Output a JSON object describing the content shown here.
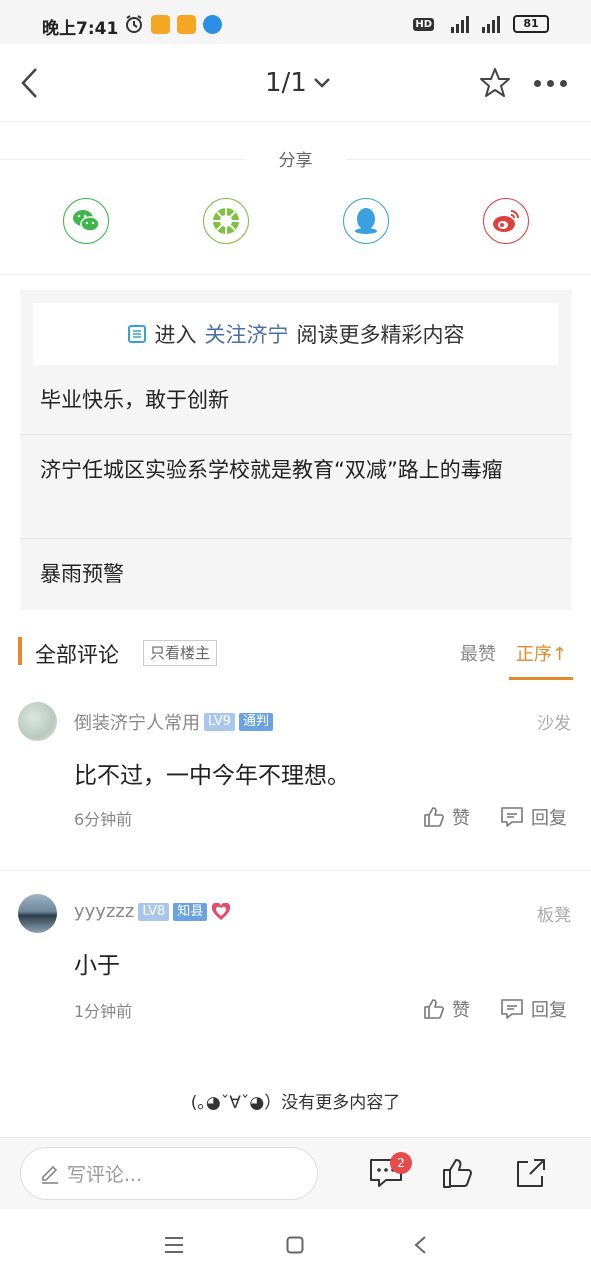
{
  "status_bar": {
    "time": "晚上7:41",
    "signal_label": "4G",
    "hd_label": "HD",
    "battery": "81"
  },
  "nav": {
    "page_indicator": "1/1",
    "back_icon": "back-arrow-icon",
    "star_icon": "star-icon",
    "more_icon": "more-dots-icon"
  },
  "share": {
    "title": "分享",
    "items": [
      {
        "name": "wechat",
        "color": "#3fb64b"
      },
      {
        "name": "moments",
        "color": "#7cc13f"
      },
      {
        "name": "qq",
        "color": "#3aa0e0"
      },
      {
        "name": "weibo",
        "color": "#e0403c"
      }
    ]
  },
  "related": {
    "enter_prefix": "进入",
    "enter_link": "关注济宁",
    "enter_suffix": "阅读更多精彩内容",
    "items": [
      "毕业快乐，敢于创新",
      "济宁任城区实验系学校就是教育“双减”路上的毒瘤",
      "暴雨预警"
    ]
  },
  "comments_header": {
    "title": "全部评论",
    "only_author": "只看楼主",
    "sort_hot": "最赞",
    "sort_order": "正序↑"
  },
  "comments": [
    {
      "user": "倒装济宁人常用",
      "level": "LV9",
      "rank": "通判",
      "floor": "沙发",
      "text": "比不过，一中今年不理想。",
      "time": "6分钟前",
      "like": "赞",
      "reply": "回复"
    },
    {
      "user": "yyyzzz",
      "level": "LV8",
      "rank": "知县",
      "floor": "板凳",
      "text": "小于",
      "time": "1分钟前",
      "like": "赞",
      "reply": "回复"
    }
  ],
  "no_more": "(｡◕ˇ∀ˇ◕）没有更多内容了",
  "bottom_bar": {
    "comment_placeholder": "写评论...",
    "comment_count": "2"
  },
  "colors": {
    "accent": "#e28a2a",
    "link": "#4a6fa5",
    "badge_red": "#e74a4a"
  }
}
